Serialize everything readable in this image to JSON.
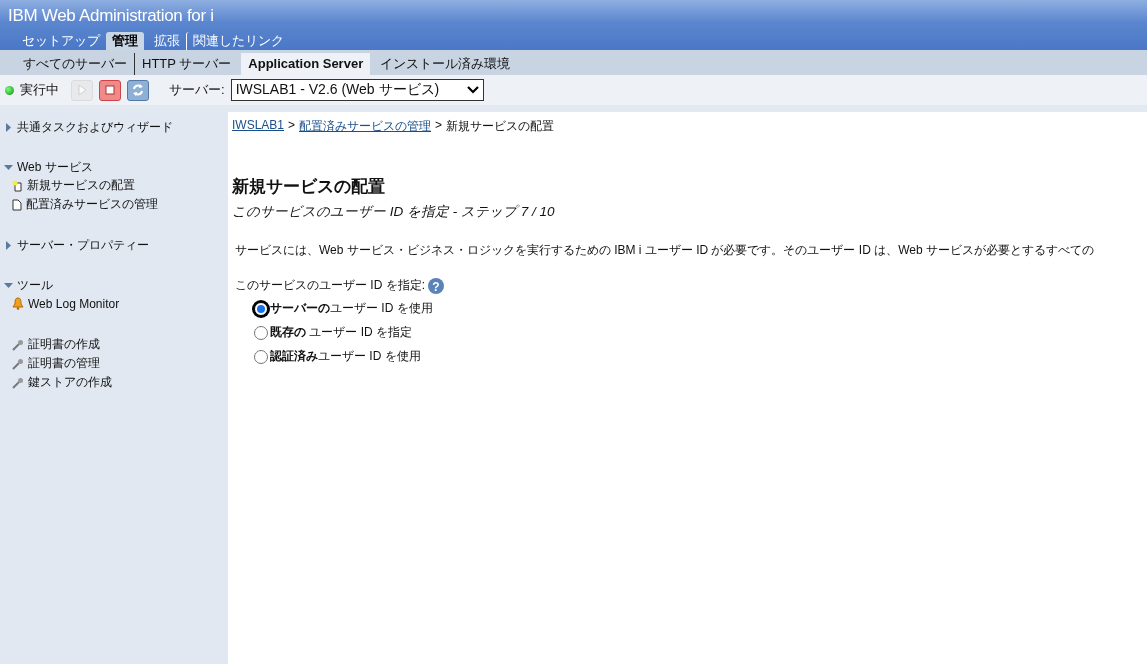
{
  "app_title": "IBM Web Administration for i",
  "main_tabs": [
    {
      "label": "セットアップ",
      "selected": false
    },
    {
      "label": "管理",
      "selected": true
    },
    {
      "label": "拡張",
      "selected": false
    },
    {
      "label": "関連したリンク",
      "selected": false
    }
  ],
  "sub_tabs": [
    {
      "label": "すべてのサーバー",
      "selected": false
    },
    {
      "label": "HTTP サーバー",
      "selected": false
    },
    {
      "label": "Application Server",
      "selected": true
    },
    {
      "label": "インストール済み環境",
      "selected": false
    }
  ],
  "toolbar": {
    "status": "実行中",
    "buttons": [
      {
        "kind": "start",
        "disabled": true
      },
      {
        "kind": "stop",
        "disabled": false
      },
      {
        "kind": "refresh",
        "disabled": false
      }
    ],
    "server_label": "サーバー:",
    "server_value": "IWSLAB1 - V2.6 (Web サービス)"
  },
  "sidebar": {
    "groups": [
      {
        "label": "共通タスクおよびウィザード",
        "expanded": false
      },
      {
        "label": "Web サービス",
        "expanded": true,
        "items": [
          {
            "label": "新規サービスの配置",
            "kind": "new"
          },
          {
            "label": "配置済みサービスの管理",
            "kind": "page"
          }
        ]
      },
      {
        "label": "サーバー・プロパティー",
        "expanded": false
      },
      {
        "label": "ツール",
        "expanded": true,
        "items": [
          {
            "label": "Web Log Monitor",
            "kind": "bell"
          }
        ]
      }
    ],
    "extra_items": [
      {
        "label": "証明書の作成",
        "kind": "wrench"
      },
      {
        "label": "証明書の管理",
        "kind": "wrench"
      },
      {
        "label": "鍵ストアの作成",
        "kind": "wrench"
      }
    ]
  },
  "breadcrumb": [
    {
      "label": "IWSLAB1",
      "link": true
    },
    {
      "separator": ">",
      "label": "配置済みサービスの管理",
      "link": true
    },
    {
      "separator": ">",
      "label": "新規サービスの配置",
      "link": false
    }
  ],
  "heading": "新規サービスの配置",
  "subheading": "このサービスのユーザー ID を指定 - ステップ 7 / 10",
  "description": "サービスには、Web サービス・ビジネス・ロジックを実行するための IBM i ユーザー ID が必要です。そのユーザー ID は、Web サービスが必要とするすべての",
  "question": "このサービスのユーザー ID を指定:",
  "help_mark": "?",
  "options": [
    {
      "label": "**サーバーの**ユーザー ID を使用",
      "selected": true
    },
    {
      "label": "**既存の** ユーザー ID を指定",
      "selected": false
    },
    {
      "label": "**認証済み**ユーザー ID を使用",
      "selected": false
    }
  ]
}
